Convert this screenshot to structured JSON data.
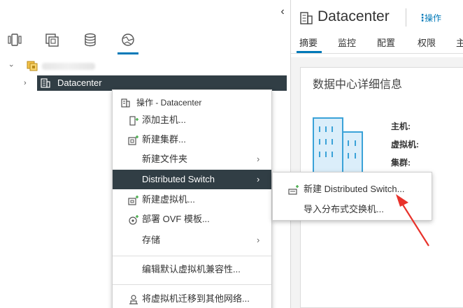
{
  "navigator": {
    "collapse_glyph": "‹",
    "tabs": [
      {
        "name": "hosts-and-clusters-icon"
      },
      {
        "name": "vms-and-templates-icon"
      },
      {
        "name": "storage-icon"
      },
      {
        "name": "networking-icon",
        "selected": true
      }
    ],
    "tree": {
      "root_label": "",
      "datacenter_label": "Datacenter"
    },
    "colors": {
      "selection_bg": "#313e45",
      "accent": "#0079b8"
    }
  },
  "panel": {
    "title": "Datacenter",
    "actions_label": "操作",
    "tabs": [
      "摘要",
      "监控",
      "配置",
      "权限",
      "主"
    ],
    "active_tab": "摘要",
    "card": {
      "title": "数据中心详细信息",
      "labels": [
        "主机:",
        "虚拟机:",
        "集群:"
      ]
    }
  },
  "context_menu": {
    "header": "操作 - Datacenter",
    "items": [
      {
        "label": "添加主机...",
        "icon": "add-host-icon"
      },
      {
        "label": "新建集群...",
        "icon": "new-cluster-icon"
      },
      {
        "label": "新建文件夹",
        "submenu": true
      },
      {
        "label": "Distributed Switch",
        "submenu": true,
        "active": true
      },
      {
        "label": "新建虚拟机...",
        "icon": "new-vm-icon"
      },
      {
        "label": "部署 OVF 模板...",
        "icon": "deploy-ovf-icon"
      },
      {
        "label": "存储",
        "submenu": true
      },
      {
        "label": "编辑默认虚拟机兼容性..."
      },
      {
        "label": "将虚拟机迁移到其他网络...",
        "icon": "migrate-network-icon"
      }
    ],
    "submenu_arrow": "›"
  },
  "submenu": {
    "items": [
      {
        "label": "新建 Distributed Switch...",
        "icon": "new-distributed-switch-icon"
      },
      {
        "label": "导入分布式交换机..."
      }
    ]
  },
  "annotation": {
    "color": "#e8322b"
  }
}
